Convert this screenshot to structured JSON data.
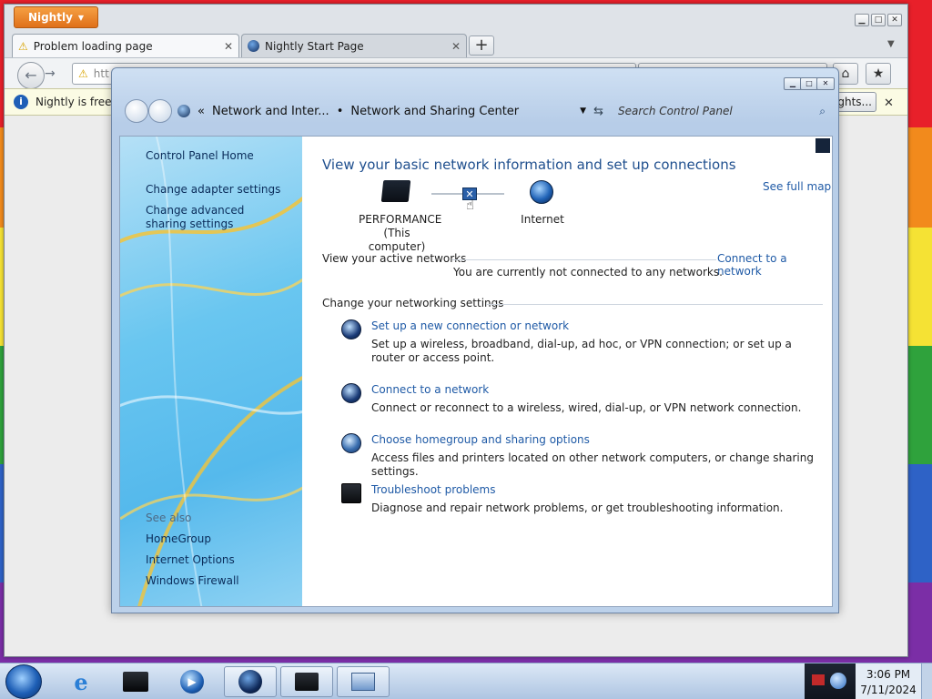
{
  "firefox": {
    "menu_label": "Nightly",
    "tabs": [
      {
        "title": "Problem loading page"
      },
      {
        "title": "Nightly Start Page"
      }
    ],
    "url_partial": "htt",
    "notification_text": "Nightly is free a",
    "notification_button": "ghts..."
  },
  "control_panel": {
    "breadcrumb": {
      "parent": "Network and Inter...",
      "current": "Network and Sharing Center"
    },
    "search_placeholder": "Search Control Panel",
    "sidebar": {
      "home": "Control Panel Home",
      "links": [
        "Change adapter settings",
        "Change advanced sharing settings"
      ],
      "see_also_heading": "See also",
      "see_also": [
        "HomeGroup",
        "Internet Options",
        "Windows Firewall"
      ]
    },
    "main": {
      "title": "View your basic network information and set up connections",
      "see_full_map": "See full map",
      "computer_name": "PERFORMANCE",
      "computer_sub": "(This computer)",
      "internet_label": "Internet",
      "active_networks_heading": "View your active networks",
      "connect_link": "Connect to a network",
      "not_connected": "You are currently not connected to any networks.",
      "settings_heading": "Change your networking settings",
      "tasks": [
        {
          "title": "Set up a new connection or network",
          "desc": "Set up a wireless, broadband, dial-up, ad hoc, or VPN connection; or set up a router or access point.",
          "icon": "network-globe-icon"
        },
        {
          "title": "Connect to a network",
          "desc": "Connect or reconnect to a wireless, wired, dial-up, or VPN network connection.",
          "icon": "network-globe-icon"
        },
        {
          "title": "Choose homegroup and sharing options",
          "desc": "Access files and printers located on other network computers, or change sharing settings.",
          "icon": "homegroup-icon"
        },
        {
          "title": "Troubleshoot problems",
          "desc": "Diagnose and repair network problems, or get troubleshooting information.",
          "icon": "troubleshoot-icon"
        }
      ]
    }
  },
  "taskbar": {
    "time": "3:06 PM",
    "date": "7/11/2024"
  },
  "colors": {
    "accent_link": "#1f5aa6",
    "firefox_orange": "#e0701a",
    "sidebar_blue": "#69c6f0"
  }
}
